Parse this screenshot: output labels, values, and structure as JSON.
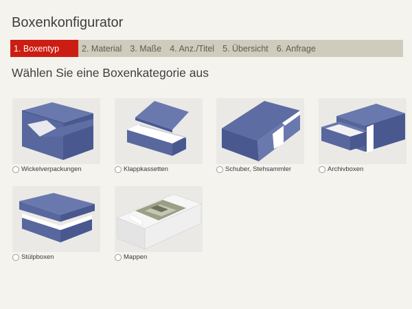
{
  "header": {
    "title": "Boxenkonfigurator"
  },
  "steps": [
    {
      "label": "1. Boxentyp",
      "active": true
    },
    {
      "label": "2. Material",
      "active": false
    },
    {
      "label": "3. Maße",
      "active": false
    },
    {
      "label": "4. Anz./Titel",
      "active": false
    },
    {
      "label": "5. Übersicht",
      "active": false
    },
    {
      "label": "6. Anfrage",
      "active": false
    }
  ],
  "main": {
    "subtitle": "Wählen Sie eine Boxenkategorie aus"
  },
  "categories": [
    {
      "label": "Wickelverpackungen",
      "icon": "wrap-box-icon",
      "selected": false
    },
    {
      "label": "Klappkassetten",
      "icon": "hinged-box-icon",
      "selected": false
    },
    {
      "label": "Schuber, Stehsammler",
      "icon": "slipcase-icon",
      "selected": false
    },
    {
      "label": "Archivboxen",
      "icon": "archive-box-icon",
      "selected": false
    },
    {
      "label": "Stülpboxen",
      "icon": "lid-box-icon",
      "selected": false
    },
    {
      "label": "Mappen",
      "icon": "folder-icon",
      "selected": false
    }
  ],
  "colors": {
    "accent": "#cc1d12",
    "stepbar": "#cfcbbd",
    "box_blue": "#58679e",
    "background": "#f4f3ee"
  }
}
